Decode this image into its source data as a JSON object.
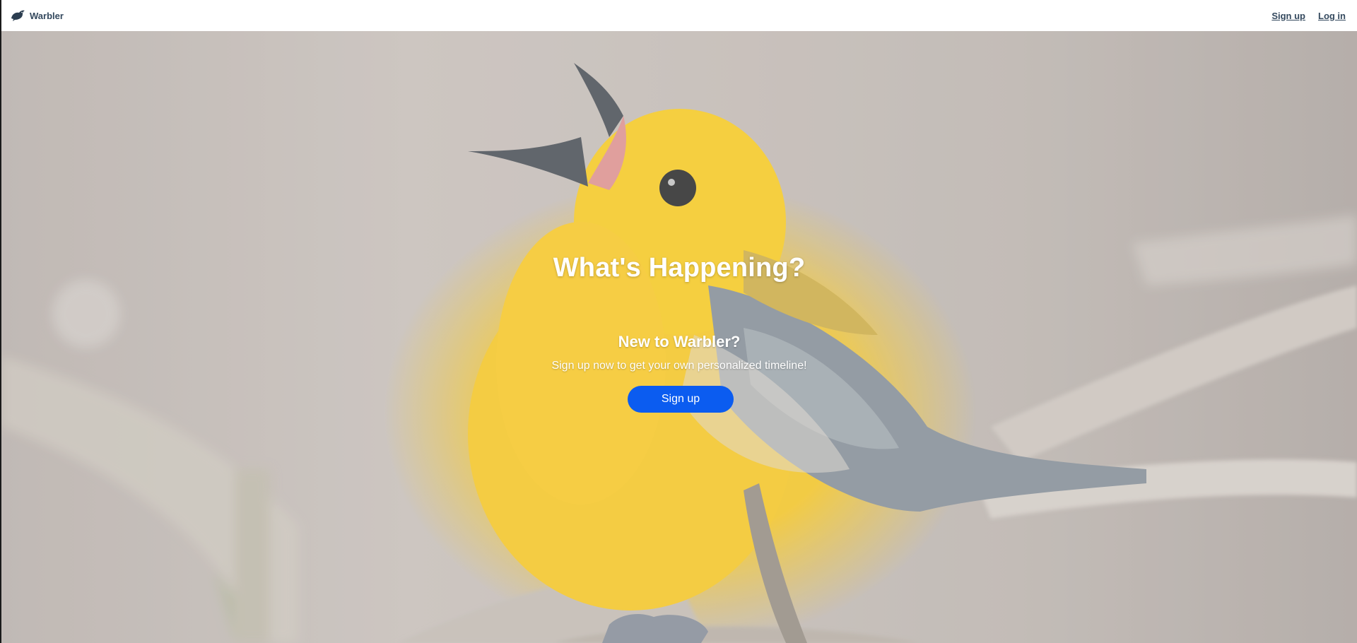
{
  "navbar": {
    "brand_name": "Warbler",
    "links": {
      "signup": "Sign up",
      "login": "Log in"
    }
  },
  "hero": {
    "title": "What's Happening?",
    "subtitle": "New to Warbler?",
    "text": "Sign up now to get your own personalized timeline!",
    "button_label": "Sign up"
  },
  "colors": {
    "button": "#0b5cf0",
    "brand_text": "#34495e",
    "bird_yellow": "#f1c21b"
  },
  "icons": {
    "brand": "bird-icon"
  }
}
